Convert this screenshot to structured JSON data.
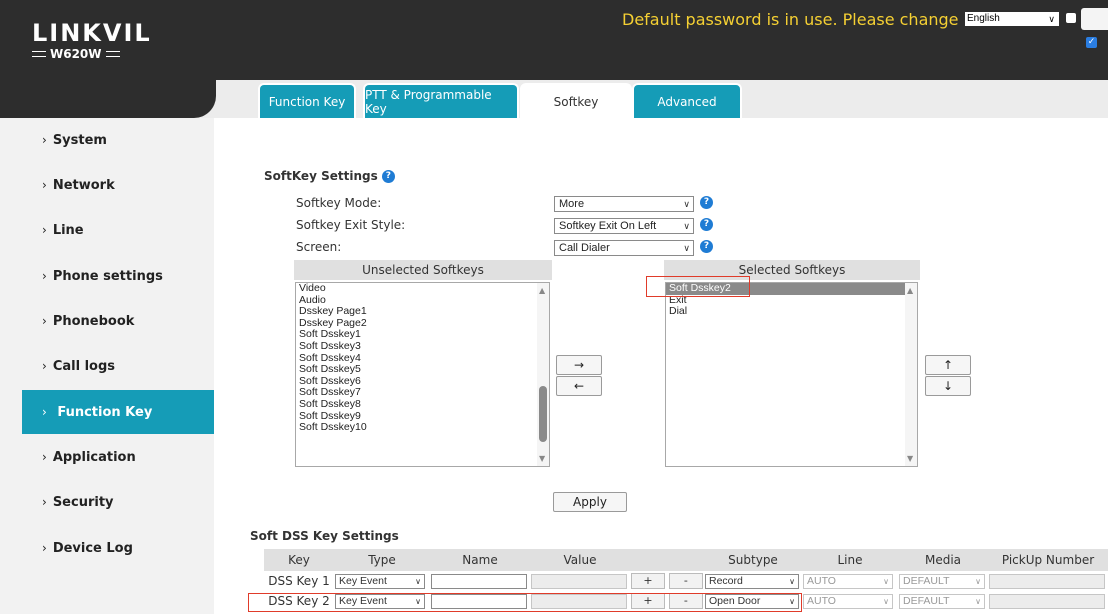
{
  "header": {
    "logo": "LINKVIL",
    "model": "W620W",
    "warning": "Default password is in use. Please change",
    "language": "English"
  },
  "tabs": [
    {
      "label": "Function Key"
    },
    {
      "label": "PTT & Programmable Key"
    },
    {
      "label": "Softkey"
    },
    {
      "label": "Advanced"
    }
  ],
  "sidebar": {
    "items": [
      {
        "label": "System"
      },
      {
        "label": "Network"
      },
      {
        "label": "Line"
      },
      {
        "label": "Phone settings"
      },
      {
        "label": "Phonebook"
      },
      {
        "label": "Call logs"
      },
      {
        "label": "Function Key"
      },
      {
        "label": "Application"
      },
      {
        "label": "Security"
      },
      {
        "label": "Device Log"
      }
    ]
  },
  "softkey_settings": {
    "title": "SoftKey Settings",
    "mode_label": "Softkey Mode:",
    "mode_value": "More",
    "exit_label": "Softkey Exit Style:",
    "exit_value": "Softkey Exit On Left",
    "screen_label": "Screen:",
    "screen_value": "Call Dialer",
    "unselected_header": "Unselected Softkeys",
    "selected_header": "Selected Softkeys",
    "unselected": [
      "Video",
      "Audio",
      "Dsskey Page1",
      "Dsskey Page2",
      "Soft Dsskey1",
      "Soft Dsskey3",
      "Soft Dsskey4",
      "Soft Dsskey5",
      "Soft Dsskey6",
      "Soft Dsskey7",
      "Soft Dsskey8",
      "Soft Dsskey9",
      "Soft Dsskey10"
    ],
    "selected": [
      "Soft Dsskey2",
      "Exit",
      "Dial"
    ],
    "move_right": "→",
    "move_left": "←",
    "move_up": "↑",
    "move_down": "↓",
    "apply": "Apply"
  },
  "dss_settings": {
    "title": "Soft DSS Key Settings",
    "columns": [
      "Key",
      "Type",
      "Name",
      "Value",
      "",
      "Subtype",
      "Line",
      "Media",
      "PickUp Number"
    ],
    "rows": [
      {
        "key": "DSS Key 1",
        "type": "Key Event",
        "subtype": "Record",
        "line": "AUTO",
        "media": "DEFAULT",
        "plus": "+",
        "minus": "-"
      },
      {
        "key": "DSS Key 2",
        "type": "Key Event",
        "subtype": "Open Door",
        "line": "AUTO",
        "media": "DEFAULT",
        "plus": "+",
        "minus": "-"
      }
    ]
  },
  "colors": {
    "accent": "#159cb7",
    "header_bg": "#2d2d2d",
    "warning": "#f5d033",
    "highlight": "#e03b2a"
  }
}
